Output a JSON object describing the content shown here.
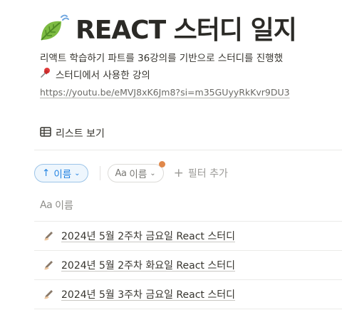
{
  "page": {
    "icon": "leaf-fluttering-in-wind-icon",
    "title": "REACT 스터디 일지",
    "description": "리액트 학습하기 파트를 36강의를 기반으로 스터디를 진행했",
    "pin_icon": "pushpin-icon",
    "lecture_label": "스터디에서 사용한 강의",
    "link": "https://youtu.be/eMVJ8xK6Jm8?si=m35GUyyRkKvr9DU3"
  },
  "view": {
    "icon": "table-icon",
    "label": "리스트 보기"
  },
  "toolbar": {
    "sort_chip": {
      "arrow": "↑",
      "label": "이름",
      "chevron": "⌄"
    },
    "property_chip": {
      "prefix": "Aa",
      "label": "이름",
      "chevron": "⌄"
    },
    "add_filter": {
      "plus": "+",
      "label": "필터 추가"
    }
  },
  "table": {
    "column_header": {
      "prefix": "Aa",
      "label": "이름"
    },
    "rows": [
      {
        "icon": "writing-hand-icon",
        "title": "2024년 5월 2주차 금요일 React 스터디"
      },
      {
        "icon": "writing-hand-icon",
        "title": "2024년 5월 2주차 화요일 React 스터디"
      },
      {
        "icon": "writing-hand-icon",
        "title": "2024년 5월 3주차 금요일 React 스터디"
      }
    ]
  },
  "colors": {
    "accent": "#2383e2",
    "notification_dot": "#e0884a",
    "leaf": "#7dbb42"
  }
}
